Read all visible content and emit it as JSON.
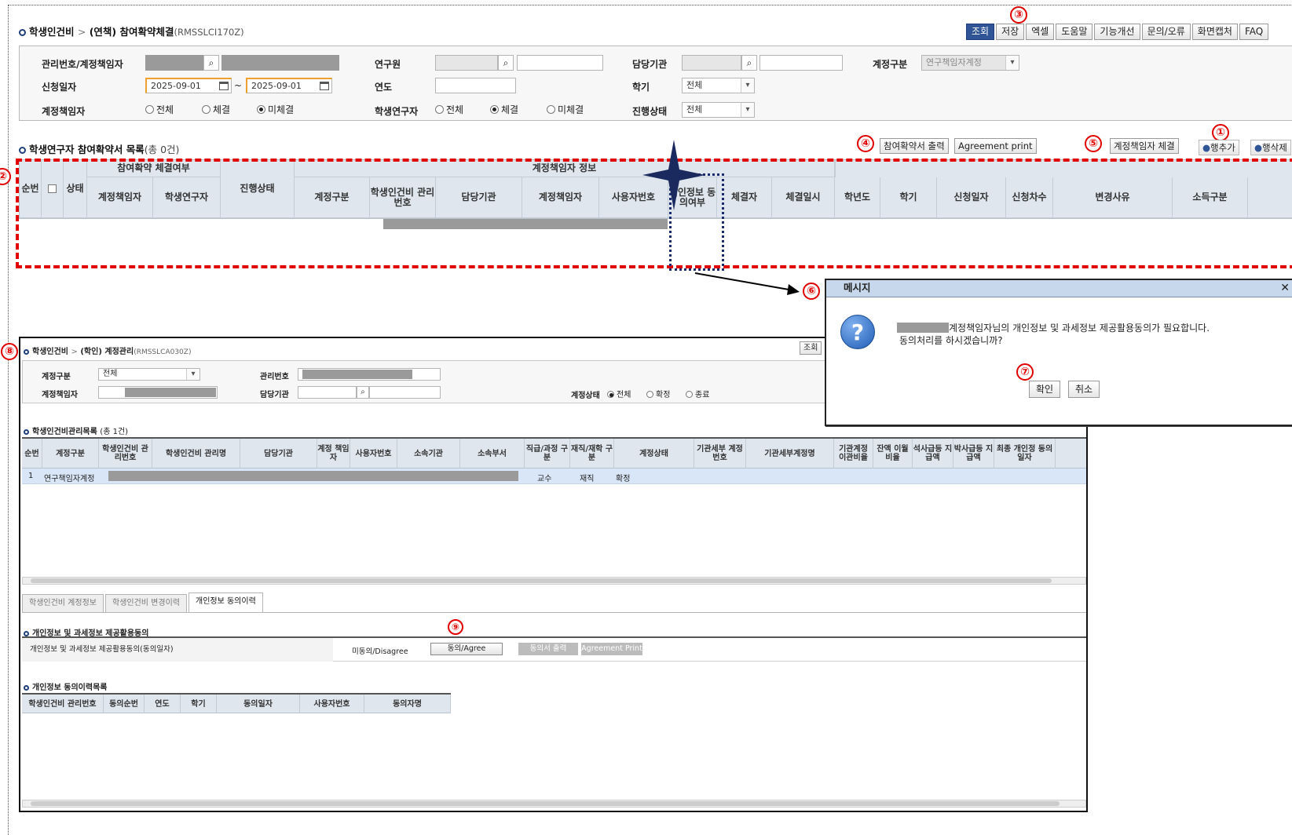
{
  "header": {
    "breadcrumb_root": "학생인건비",
    "breadcrumb_sep": ">",
    "breadcrumb_page": "(연책) 참여확약체결",
    "screen_code": "(RMSSLCI170Z)",
    "buttons": [
      "조회",
      "저장",
      "엑셀",
      "도움말",
      "기능개선",
      "문의/오류",
      "화면캡처",
      "FAQ"
    ]
  },
  "search": {
    "mgmt_label": "관리번호/계정책임자",
    "researcher_label": "연구원",
    "org_label": "담당기관",
    "account_type_label": "계정구분",
    "account_type_value": "연구책임자계정",
    "apply_date_label": "신청일자",
    "date_from": "2025-09-01",
    "date_tilde": "~",
    "date_to": "2025-09-01",
    "year_label": "연도",
    "semester_label": "학기",
    "semester_value": "전체",
    "owner_label": "계정책임자",
    "owner_radios": [
      "전체",
      "체결",
      "미체결"
    ],
    "owner_selected": 2,
    "student_label": "학생연구자",
    "student_radios": [
      "전체",
      "체결",
      "미체결"
    ],
    "student_selected": 1,
    "status_label": "진행상태",
    "status_value": "전체"
  },
  "list": {
    "title": "학생연구자 참여확약서 목록",
    "count": "(총 0건)",
    "print_button": "참여확약서 출력",
    "agreement_button": "Agreement print",
    "sign_button": "계정책임자 체결",
    "add_row": "행추가",
    "del_row": "행삭제",
    "group_confirm": "참여확약 체결여부",
    "group_owner": "계정책임자 정보",
    "columns": [
      "순번",
      "상태",
      "계정책임자",
      "학생연구자",
      "진행상태",
      "계정구분",
      "학생인건비 관리번호",
      "담당기관",
      "계정책임자",
      "사용자번호",
      "개인정보 동의여부",
      "체결자",
      "체결일시",
      "학년도",
      "학기",
      "신청일자",
      "신청차수",
      "변경사유",
      "소득구분"
    ]
  },
  "annotations": [
    "①",
    "②",
    "③",
    "④",
    "⑤",
    "⑥",
    "⑦",
    "⑧",
    "⑨"
  ],
  "dialog": {
    "title": "메시지",
    "close": "✕",
    "line1": "계정책임자님의 개인정보 및 과세정보 제공활용동의가 필요합니다.",
    "line2": "동의처리를 하시겠습니까?",
    "ok": "확인",
    "cancel": "취소"
  },
  "inner": {
    "breadcrumb_root": "학생인건비",
    "breadcrumb_sep": ">",
    "breadcrumb_page": "(학인) 계정관리",
    "screen_code": "(RMSSLCA030Z)",
    "search_button": "조회",
    "account_type_label": "계정구분",
    "account_type_value": "전체",
    "mgmt_label": "관리번호",
    "owner_label": "계정책임자",
    "org_label": "담당기관",
    "state_label": "계정상태",
    "state_radios": [
      "전체",
      "확정",
      "종료"
    ],
    "state_selected": 0,
    "list_title": "학생인건비관리목록",
    "list_count": "(총 1건)",
    "columns": [
      "순번",
      "계정구분",
      "학생인건비 관리번호",
      "학생인건비 관리명",
      "담당기관",
      "계정 책임자",
      "사용자번호",
      "소속기관",
      "소속부서",
      "직급/과정 구분",
      "재직/재학 구분",
      "계정상태",
      "기관세부 계정번호",
      "기관세부계정명",
      "기관계정 이관비율",
      "잔액 이월비율",
      "석사급등 지급액",
      "박사급등 지급액",
      "최종 개인정 동의일자"
    ],
    "row": {
      "no": "1",
      "type": "연구책임자계정",
      "rank": "교수",
      "employ": "재직",
      "state": "확정"
    },
    "tabs": [
      "학생인건비 계정정보",
      "학생인건비 변경이력",
      "개인정보 동의이력"
    ],
    "consent_title": "개인정보 및 과세정보 제공활용동의",
    "consent_label": "개인정보 및 과세정보 제공활용동의(동의일자)",
    "consent_status": "미동의/Disagree",
    "agree_button": "동의/Agree",
    "print_button": "동의서 출력",
    "agreement_button": "Agreement Print",
    "history_title": "개인정보 동의이력목록",
    "history_columns": [
      "학생인건비 관리번호",
      "동의순번",
      "연도",
      "학기",
      "동의일자",
      "사용자번호",
      "동의자명"
    ]
  }
}
